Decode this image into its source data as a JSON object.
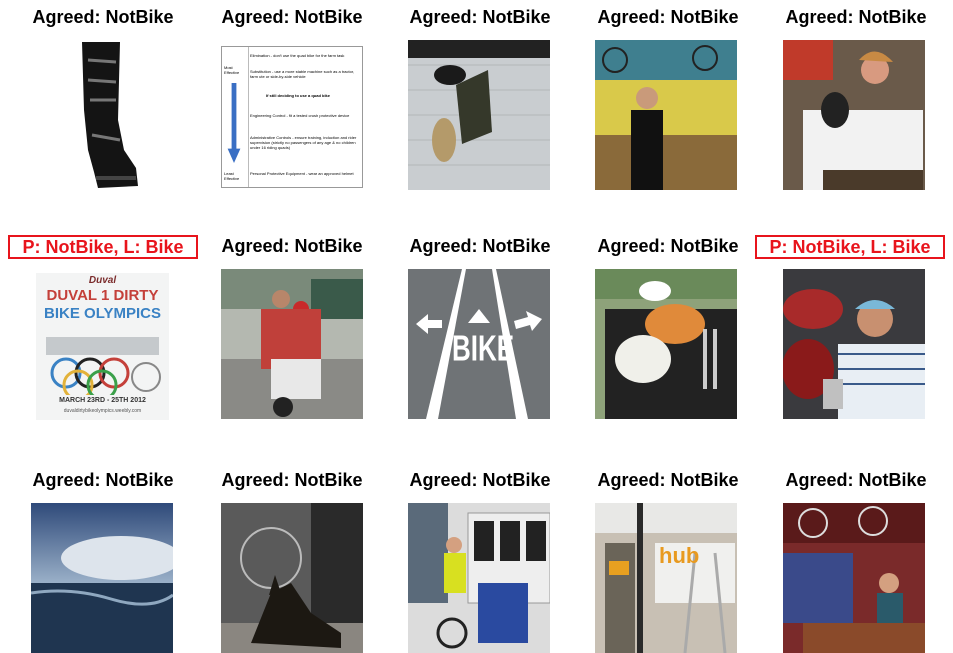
{
  "title": "",
  "colors": {
    "agreed": "#000000",
    "mismatch": "#e8141c"
  },
  "grid": [
    {
      "row": 1,
      "label": "Agreed: NotBike",
      "status": "agreed",
      "image": "black-motocross-boot"
    },
    {
      "row": 1,
      "label": "Agreed: NotBike",
      "status": "agreed",
      "image": "hierarchy-of-controls-document"
    },
    {
      "row": 1,
      "label": "Agreed: NotBike",
      "status": "agreed",
      "image": "wall-mounted-object"
    },
    {
      "row": 1,
      "label": "Agreed: NotBike",
      "status": "agreed",
      "image": "man-in-bike-shop"
    },
    {
      "row": 1,
      "label": "Agreed: NotBike",
      "status": "agreed",
      "image": "woman-holding-dog"
    },
    {
      "row": 2,
      "label": "P: NotBike, L: Bike",
      "status": "mismatch",
      "image": "bike-olympics-poster"
    },
    {
      "row": 2,
      "label": "Agreed: NotBike",
      "status": "agreed",
      "image": "family-on-scooter"
    },
    {
      "row": 2,
      "label": "Agreed: NotBike",
      "status": "agreed",
      "image": "bike-lane-road-marking"
    },
    {
      "row": 2,
      "label": "Agreed: NotBike",
      "status": "agreed",
      "image": "breakfast-tray"
    },
    {
      "row": 2,
      "label": "P: NotBike, L: Bike",
      "status": "mismatch",
      "image": "man-with-trophy"
    },
    {
      "row": 3,
      "label": "Agreed: NotBike",
      "status": "agreed",
      "image": "waterfall-sky"
    },
    {
      "row": 3,
      "label": "Agreed: NotBike",
      "status": "agreed",
      "image": "dog-lying-by-bike"
    },
    {
      "row": 3,
      "label": "Agreed: NotBike",
      "status": "agreed",
      "image": "cyclist-near-bus"
    },
    {
      "row": 3,
      "label": "Agreed: NotBike",
      "status": "agreed",
      "image": "storefront-ladder"
    },
    {
      "row": 3,
      "label": "Agreed: NotBike",
      "status": "agreed",
      "image": "man-in-bike-store"
    }
  ],
  "document_text": {
    "most_effective": "Most Effective",
    "least_effective": "Least Effective",
    "lines": [
      "Elimination - don't use the quad bike for the farm task",
      "Substitution - use a more stable machine such as a tractor, farm ute or side-by-side vehicle",
      "If still deciding to use a quad bike",
      "Engineering Control - fit a tested crush protective device",
      "Administrative Controls - ensure training, induction and rider supervision (strictly no passengers of any age & no children under 16 riding quads)",
      "Personal Protective Equipment - wear an approved helmet"
    ]
  },
  "poster_text": {
    "top": "Duval",
    "line1": "DUVAL 1 DIRTY",
    "line2": "BIKE OLYMPICS",
    "date": "MARCH 23RD - 25TH 2012",
    "url": "duvaldirtybikeolympics.weebly.com"
  },
  "road_text": "BIKE",
  "store_sign": "hub"
}
